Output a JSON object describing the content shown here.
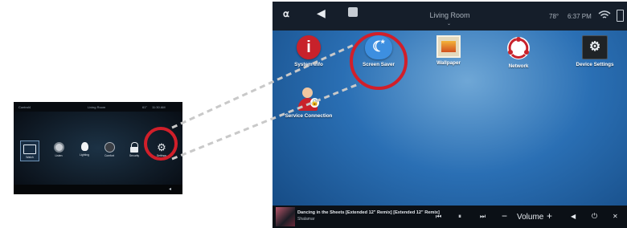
{
  "small_screen": {
    "topbar": {
      "brand": "Control4",
      "room": "Living Room",
      "temperature": "61°",
      "time": "11:30 AM"
    },
    "tiles": [
      {
        "label": "Watch",
        "icon": "tv-icon"
      },
      {
        "label": "Listen",
        "icon": "speaker-icon"
      },
      {
        "label": "Lighting",
        "icon": "bulb-icon"
      },
      {
        "label": "Comfort",
        "icon": "thermostat-icon"
      },
      {
        "label": "Security",
        "icon": "lock-icon"
      },
      {
        "label": "Settings",
        "icon": "gear-icon"
      }
    ]
  },
  "large_screen": {
    "topbar": {
      "room": "Living Room",
      "temperature": "78°",
      "time": "6:37 PM"
    },
    "apps": [
      {
        "label": "System Info",
        "icon": "info-icon",
        "color": "#c8222b"
      },
      {
        "label": "Screen Saver",
        "icon": "moon-star-icon",
        "color": "#3d8fe0"
      },
      {
        "label": "Wallpaper",
        "icon": "picture-icon",
        "color": "#d98a2a"
      },
      {
        "label": "Network",
        "icon": "network-icon",
        "color": "#c8222b"
      },
      {
        "label": "Device Settings",
        "icon": "settings-icon",
        "color": "#222222"
      },
      {
        "label": "Service Connection",
        "icon": "user-lock-icon",
        "color": "#c8222b"
      }
    ],
    "now_playing": {
      "title": "Dancing in the Sheets [Extended 12\" Remix] [Extended 12\" Remix]",
      "artist": "Shalamar"
    },
    "controls": {
      "volume_label": "Volume",
      "minus": "−",
      "plus": "+"
    }
  },
  "highlight_color": "#d11f2a"
}
